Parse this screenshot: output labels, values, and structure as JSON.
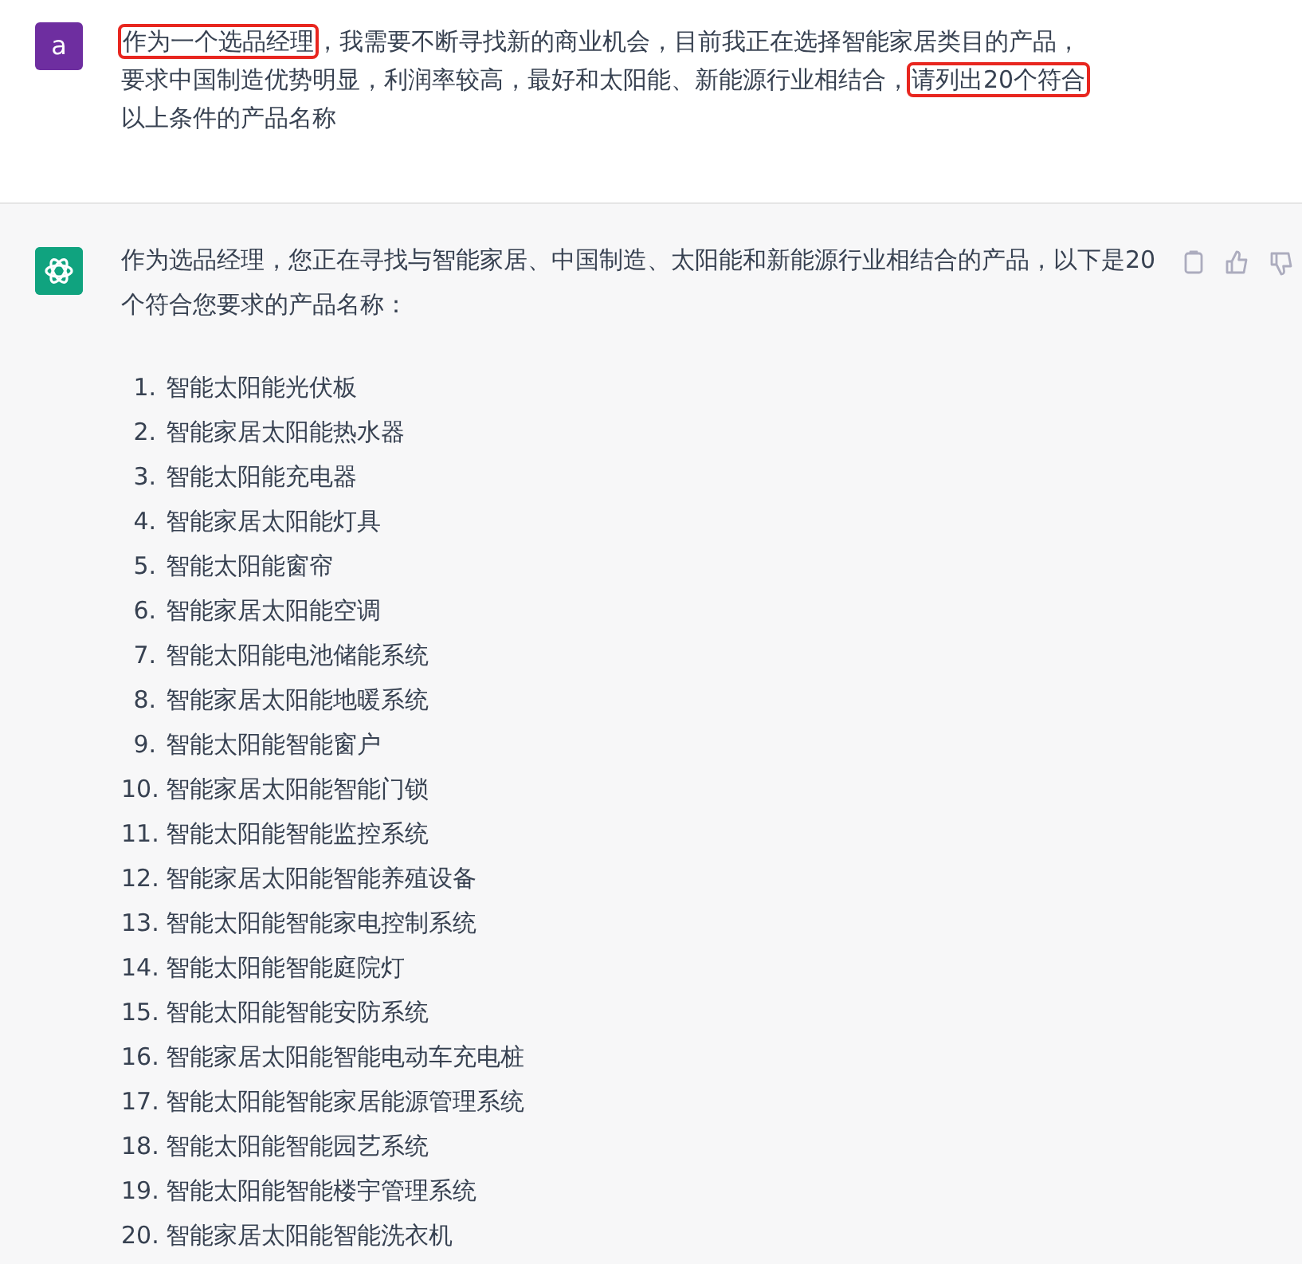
{
  "user_message": {
    "avatar_letter": "a",
    "lines": [
      [
        {
          "text": "作为一个选品经理",
          "highlighted": true
        },
        {
          "text": "，我需要不断寻找新的商业机会，目前我正在选择智能家居类目的产品，",
          "highlighted": false
        }
      ],
      [
        {
          "text": "要求中国制造优势明显，利润率较高，最好和太阳能、新能源行业相结合，",
          "highlighted": false
        },
        {
          "text": "请列出20个符合",
          "highlighted": true
        }
      ],
      [
        {
          "text": "以上条件的产品名称",
          "highlighted": false
        }
      ]
    ]
  },
  "assistant_message": {
    "intro": "作为选品经理，您正在寻找与智能家居、中国制造、太阳能和新能源行业相结合的产品，以下是20个符合您要求的产品名称：",
    "items": [
      {
        "number": "1.",
        "text": "智能太阳能光伏板"
      },
      {
        "number": "2.",
        "text": "智能家居太阳能热水器"
      },
      {
        "number": "3.",
        "text": "智能太阳能充电器"
      },
      {
        "number": "4.",
        "text": "智能家居太阳能灯具"
      },
      {
        "number": "5.",
        "text": "智能太阳能窗帘"
      },
      {
        "number": "6.",
        "text": "智能家居太阳能空调"
      },
      {
        "number": "7.",
        "text": "智能太阳能电池储能系统"
      },
      {
        "number": "8.",
        "text": "智能家居太阳能地暖系统"
      },
      {
        "number": "9.",
        "text": "智能太阳能智能窗户"
      },
      {
        "number": "10.",
        "text": "智能家居太阳能智能门锁"
      },
      {
        "number": "11.",
        "text": "智能太阳能智能监控系统"
      },
      {
        "number": "12.",
        "text": "智能家居太阳能智能养殖设备"
      },
      {
        "number": "13.",
        "text": "智能太阳能智能家电控制系统"
      },
      {
        "number": "14.",
        "text": "智能太阳能智能庭院灯"
      },
      {
        "number": "15.",
        "text": "智能太阳能智能安防系统"
      },
      {
        "number": "16.",
        "text": "智能家居太阳能智能电动车充电桩"
      },
      {
        "number": "17.",
        "text": "智能太阳能智能家居能源管理系统"
      },
      {
        "number": "18.",
        "text": "智能太阳能智能园艺系统"
      },
      {
        "number": "19.",
        "text": "智能太阳能智能楼宇管理系统"
      },
      {
        "number": "20.",
        "text": "智能家居太阳能智能洗衣机"
      }
    ]
  }
}
